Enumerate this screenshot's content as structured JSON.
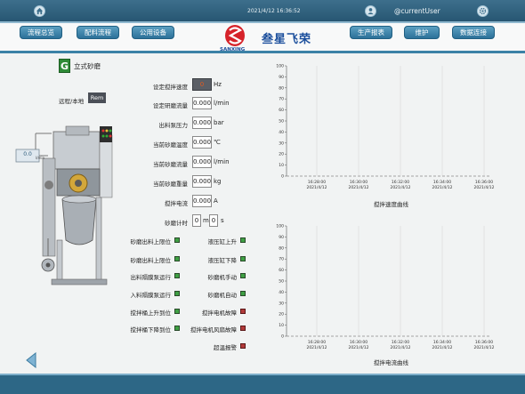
{
  "header": {
    "datetime": "2021/4/12 16:36:52",
    "user": "@currentUser",
    "icons": {
      "home": "home-icon",
      "user": "user-icon",
      "settings": "gear-icon"
    }
  },
  "nav": {
    "left": [
      "流程总览",
      "配料流程",
      "公用设备"
    ],
    "right": [
      "生产报表",
      "维护",
      "数据连接"
    ],
    "logo_text": "叁星飞荣",
    "logo_brand": "SANXING"
  },
  "machine": {
    "badge": "G",
    "title": "立式砂磨",
    "mode_label": "远程/本地",
    "mode_value": "Rem",
    "gauge_value": "0.0",
    "gauge_unit": "l/min"
  },
  "params": [
    {
      "label": "设定搅拌速度",
      "value": "0",
      "unit": "Hz",
      "highlight": true
    },
    {
      "label": "设定研磨流量",
      "value": "0.000",
      "unit": "l/min"
    },
    {
      "label": "出料泵压力",
      "value": "0.000",
      "unit": "bar"
    },
    {
      "label": "当前砂磨温度",
      "value": "0.000",
      "unit": "℃"
    },
    {
      "label": "当前砂磨流量",
      "value": "0.000",
      "unit": "l/min"
    },
    {
      "label": "当前砂磨重量",
      "value": "0.000",
      "unit": "kg"
    },
    {
      "label": "搅拌电流",
      "value": "0.000",
      "unit": "A"
    }
  ],
  "timer": {
    "label": "砂磨计时",
    "minutes": "0",
    "min_unit": "m",
    "seconds": "0",
    "sec_unit": "s"
  },
  "status_left": [
    {
      "label": "砂磨出料上限位",
      "color": "green"
    },
    {
      "label": "砂磨出料上限位",
      "color": "green"
    },
    {
      "label": "出料隔膜泵运行",
      "color": "green"
    },
    {
      "label": "入料隔膜泵运行",
      "color": "green"
    },
    {
      "label": "搅拌桶上升到位",
      "color": "green"
    },
    {
      "label": "搅拌桶下降到位",
      "color": "green"
    }
  ],
  "status_right": [
    {
      "label": "液压缸上升",
      "color": "green"
    },
    {
      "label": "液压缸下降",
      "color": "green"
    },
    {
      "label": "砂磨机手动",
      "color": "green"
    },
    {
      "label": "砂磨机自动",
      "color": "green"
    },
    {
      "label": "搅拌电机故障",
      "color": "red"
    },
    {
      "label": "搅拌电机风扇故障",
      "color": "red"
    },
    {
      "label": "超温报警",
      "color": "red"
    }
  ],
  "chart_data": [
    {
      "type": "line",
      "title": "搅拌速度曲线",
      "ylim": [
        0,
        100
      ],
      "yticks": [
        0,
        10,
        20,
        30,
        40,
        50,
        60,
        70,
        80,
        90,
        100
      ],
      "x_times": [
        "16:28:00",
        "16:30:00",
        "16:32:00",
        "16:34:00",
        "16:36:00"
      ],
      "x_dates": [
        "2021/4/12",
        "2021/4/12",
        "2021/4/12",
        "2021/4/12",
        "2021/4/12"
      ],
      "series": [
        {
          "values": []
        }
      ],
      "grid": "vertical"
    },
    {
      "type": "line",
      "title": "搅拌电流曲线",
      "ylim": [
        0,
        100
      ],
      "yticks": [
        0,
        10,
        20,
        30,
        40,
        50,
        60,
        70,
        80,
        90,
        100
      ],
      "x_times": [
        "16:28:00",
        "16:30:00",
        "16:32:00",
        "16:34:00",
        "16:36:00"
      ],
      "x_dates": [
        "2021/4/12",
        "2021/4/12",
        "2021/4/12",
        "2021/4/12",
        "2021/4/12"
      ],
      "series": [
        {
          "values": []
        }
      ],
      "grid": "vertical"
    }
  ]
}
